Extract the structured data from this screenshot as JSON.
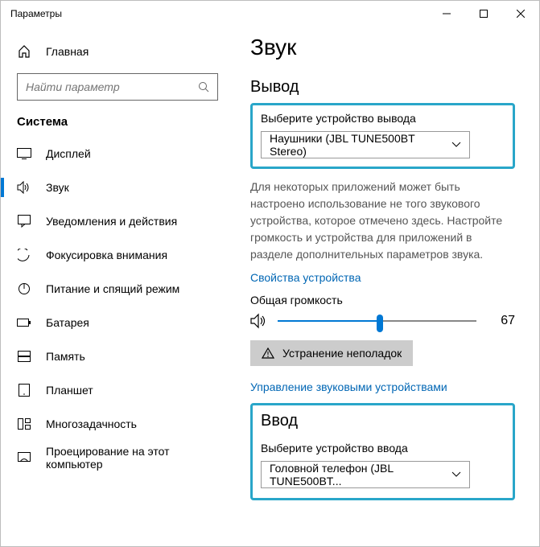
{
  "window": {
    "title": "Параметры"
  },
  "sidebar": {
    "home": "Главная",
    "search_placeholder": "Найти параметр",
    "group": "Система",
    "items": [
      {
        "label": "Дисплей"
      },
      {
        "label": "Звук"
      },
      {
        "label": "Уведомления и действия"
      },
      {
        "label": "Фокусировка внимания"
      },
      {
        "label": "Питание и спящий режим"
      },
      {
        "label": "Батарея"
      },
      {
        "label": "Память"
      },
      {
        "label": "Планшет"
      },
      {
        "label": "Многозадачность"
      },
      {
        "label": "Проецирование на этот компьютер"
      }
    ]
  },
  "main": {
    "title": "Звук",
    "output_heading": "Вывод",
    "output_label": "Выберите устройство вывода",
    "output_device": "Наушники (JBL TUNE500BT Stereo)",
    "output_desc": "Для некоторых приложений может быть настроено использование не того звукового устройства, которое отмечено здесь. Настройте громкость и устройства для приложений в разделе дополнительных параметров звука.",
    "device_props": "Свойства устройства",
    "volume_label": "Общая громкость",
    "volume_value": "67",
    "troubleshoot": "Устранение неполадок",
    "manage_devices": "Управление звуковыми устройствами",
    "input_heading": "Ввод",
    "input_label": "Выберите устройство ввода",
    "input_device": "Головной телефон (JBL TUNE500BT..."
  }
}
